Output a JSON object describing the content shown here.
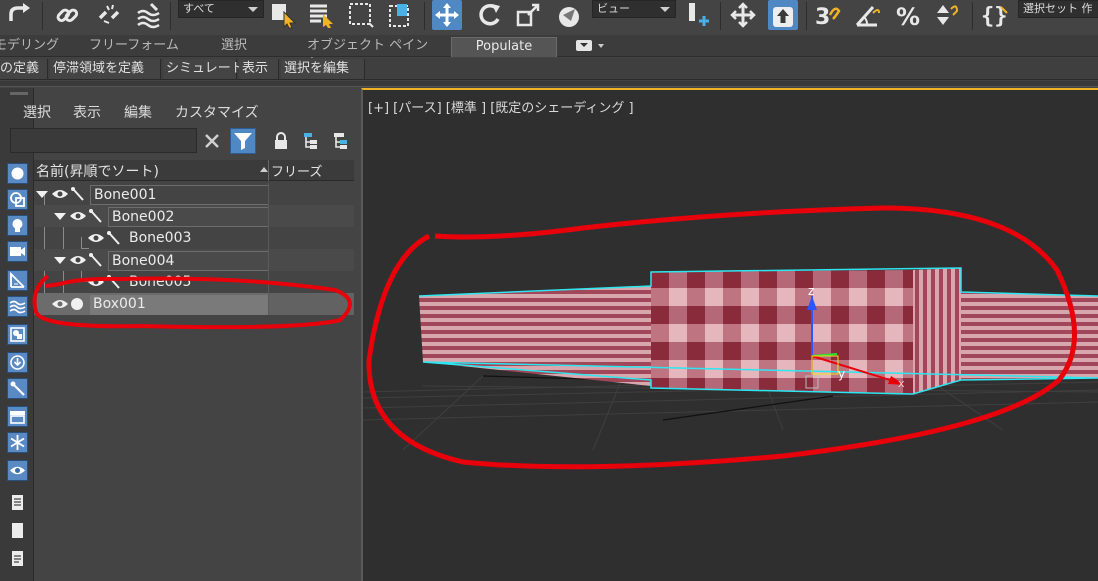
{
  "toolbar": {
    "selection_filter": "すべて",
    "reference_coordinate": "ビュー",
    "named_selection_set": "選択セット 作"
  },
  "ribbon": {
    "tabs": [
      "モデリング",
      "フリーフォーム",
      "選択",
      "オブジェクト ペイント",
      "Populate"
    ],
    "active_tab": "Populate",
    "buttons": [
      "の定義",
      "停滞領域を定義",
      "シミュレート",
      "表示",
      "選択を編集"
    ]
  },
  "scene_explorer": {
    "menu": [
      "選択",
      "表示",
      "編集",
      "カスタマイズ"
    ],
    "search_placeholder": "",
    "columns": {
      "name": "名前(昇順でソート)",
      "freeze": "フリーズ"
    },
    "nodes": [
      {
        "name": "Bone001",
        "depth": 0,
        "type": "bone",
        "expanded": true
      },
      {
        "name": "Bone002",
        "depth": 1,
        "type": "bone",
        "expanded": true
      },
      {
        "name": "Bone003",
        "depth": 2,
        "type": "bone",
        "expanded": false
      },
      {
        "name": "Bone004",
        "depth": 1,
        "type": "bone",
        "expanded": true
      },
      {
        "name": "Bone005",
        "depth": 2,
        "type": "bone",
        "expanded": false
      },
      {
        "name": "Box001",
        "depth": 0,
        "type": "geometry",
        "selected": true
      }
    ]
  },
  "viewport": {
    "label": "[+] [パース] [標準 ] [既定のシェーディング ]",
    "gizmo_axes": [
      "z",
      "y",
      "x"
    ]
  },
  "colors": {
    "accent": "#4f88c2",
    "viewport_active_border": "#f0b323",
    "annotation": "#e8000b",
    "selection_outline": "#2ee6f0",
    "checker_dark": "#8a2b3c",
    "checker_light": "#e6b6bd"
  }
}
